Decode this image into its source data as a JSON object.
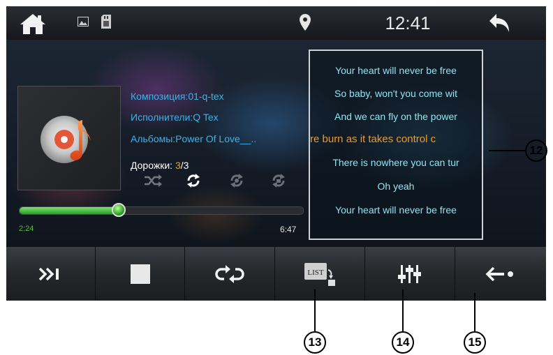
{
  "statusbar": {
    "time": "12:41",
    "icons": [
      "home-icon",
      "image-icon",
      "sd-card-icon",
      "location-pin-icon",
      "back-arrow-icon"
    ]
  },
  "track_info": {
    "composition": "Композиция:01-q-tex",
    "artists": "Исполнители:Q Tex",
    "album": "Альбомы:Power Of Love__..",
    "tracks_label": "Дорожки: ",
    "track_current": "3",
    "track_total": "/3"
  },
  "play_modes": [
    "shuffle-icon",
    "repeat-all-icon",
    "repeat-one-icon",
    "repeat-folder-icon"
  ],
  "progress": {
    "elapsed": "2:24",
    "total": "6:47",
    "fraction": 0.353
  },
  "lyrics": [
    "Your heart will never be free",
    "So baby, won't you come wit",
    "And we can fly on the power",
    "re burn as it takes control c",
    "There is nowhere you can tur",
    "Oh yeah",
    "Your heart will never be free"
  ],
  "lyrics_active_index": 3,
  "controls": [
    "next-track-icon",
    "stop-icon",
    "repeat-icon",
    "list-icon",
    "equalizer-icon",
    "back-icon"
  ],
  "controls_list_label": "LIST",
  "callouts": {
    "c12": "12",
    "c13": "13",
    "c14": "14",
    "c15": "15"
  },
  "colors": {
    "info_text": "#3ab4e8",
    "lyrics_text": "#8ee6f2",
    "lyrics_active": "#f09a20",
    "progress_green": "#3fbf35"
  }
}
